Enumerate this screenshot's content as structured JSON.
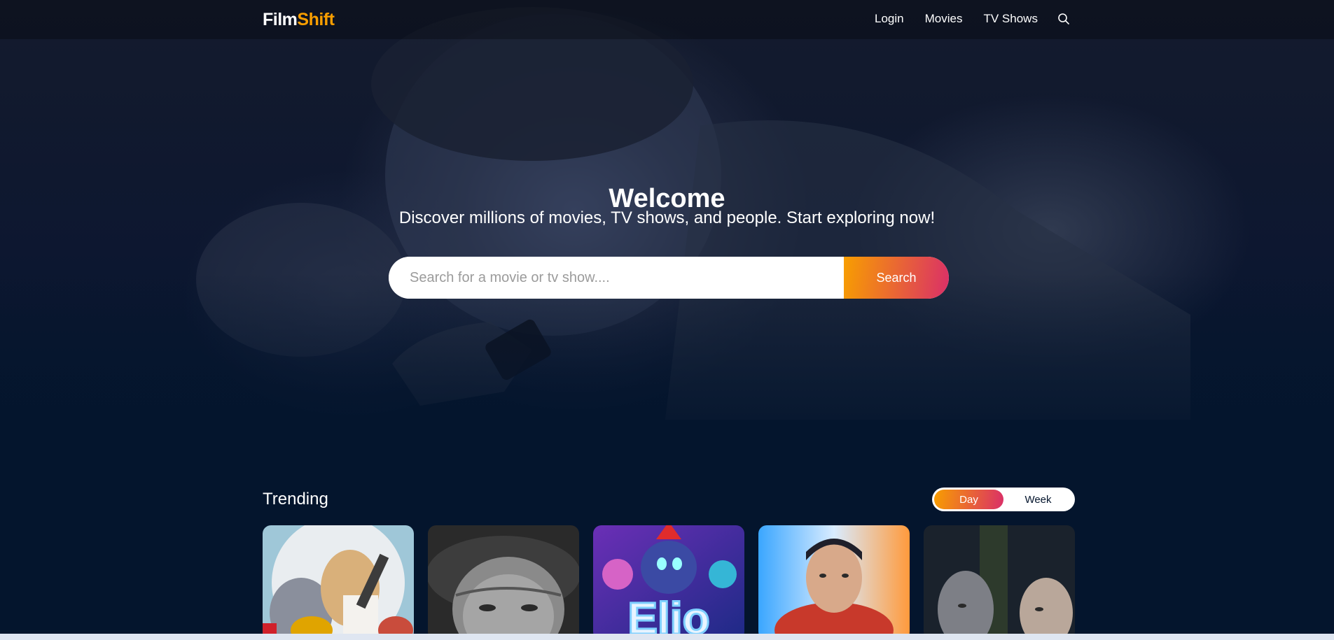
{
  "header": {
    "logo_part1": "Film",
    "logo_part2": "Shift",
    "nav": [
      "Login",
      "Movies",
      "TV Shows"
    ],
    "search_icon": "search-icon"
  },
  "hero": {
    "title": "Welcome",
    "subtitle": "Discover millions of movies, TV shows, and people. Start exploring now!",
    "search_placeholder": "Search for a movie or tv show....",
    "search_button": "Search"
  },
  "trending": {
    "title": "Trending",
    "tabs": [
      "Day",
      "Week"
    ],
    "active_tab": "Day",
    "card_count": 5
  },
  "colors": {
    "accent_start": "#f89e00",
    "accent_end": "#da2f68",
    "background": "#04152d"
  }
}
